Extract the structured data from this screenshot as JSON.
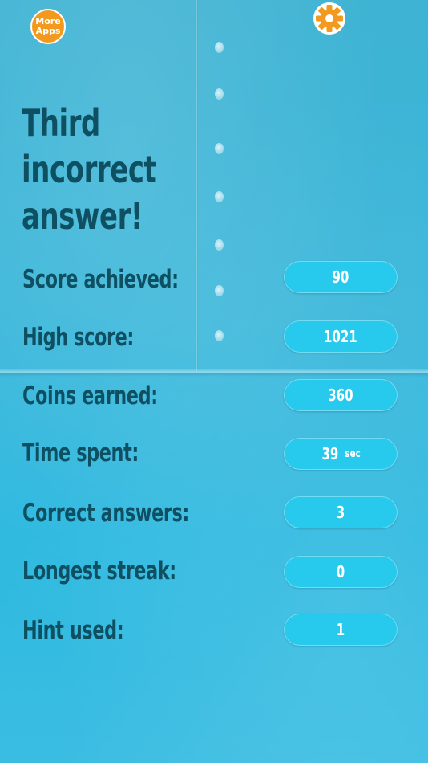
{
  "header": {
    "more_apps_line1": "More",
    "more_apps_line2": "Apps",
    "settings_icon": "gear-icon"
  },
  "title": {
    "line1": "Third incorrect",
    "line2": "answer!"
  },
  "stats": [
    {
      "label": "Score achieved:",
      "value": "90",
      "unit": ""
    },
    {
      "label": "High score:",
      "value": "1021",
      "unit": ""
    },
    {
      "label": "Coins earned:",
      "value": "360",
      "unit": ""
    },
    {
      "label": "Time spent:",
      "value": "39",
      "unit": "sec"
    },
    {
      "label": "Correct answers:",
      "value": "3",
      "unit": ""
    },
    {
      "label": "Longest streak:",
      "value": "0",
      "unit": ""
    },
    {
      "label": "Hint used:",
      "value": "1",
      "unit": ""
    }
  ],
  "colors": {
    "accent": "#f39a1e",
    "pill": "#27c9ec",
    "text": "#0f4f62"
  }
}
